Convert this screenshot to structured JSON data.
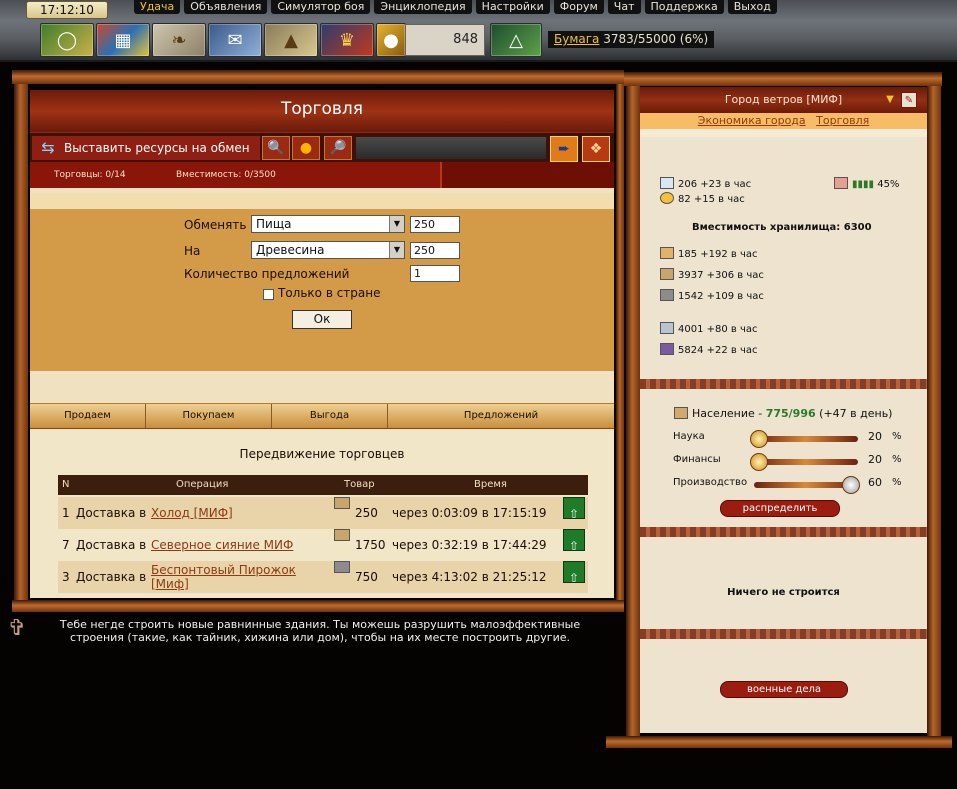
{
  "topbar": {
    "clock": "17:12:10",
    "menu": [
      "Удача",
      "Объявления",
      "Симулятор боя",
      "Энциклопедия",
      "Настройки",
      "Форум",
      "Чат",
      "Поддержка",
      "Выход"
    ],
    "gold": "848",
    "paper_label": "Бумага",
    "paper_value": "3783/55000 (6%)"
  },
  "trade": {
    "title": "Торговля",
    "exchange_button": "Выставить ресурсы на обмен",
    "traders_label": "Торговцы: 0/14",
    "capacity_label": "Вместимость: 0/3500",
    "form": {
      "give_label": "Обменять",
      "give_value": "Пища",
      "give_amount": "250",
      "get_label": "На",
      "get_value": "Древесина",
      "get_amount": "250",
      "count_label": "Количество предложений",
      "count_value": "1",
      "only_country_label": "Только в стране",
      "ok_label": "Ок"
    },
    "offers_columns": [
      "Продаем",
      "Покупаем",
      "Выгода",
      "Предложений"
    ],
    "movement_title": "Передвижение торговцев",
    "movement_columns": [
      "N",
      "Операция",
      "Товар",
      "Время"
    ],
    "movements": [
      {
        "n": "1",
        "op": "Доставка в",
        "dest": "Холод [МИФ]",
        "amount": "250",
        "time": "через 0:03:09 в 17:15:19"
      },
      {
        "n": "7",
        "op": "Доставка в",
        "dest": "Северное сияние МИФ",
        "amount": "1750",
        "time": "через 0:32:19 в 17:44:29"
      },
      {
        "n": "3",
        "op": "Доставка в",
        "dest": "Беспонтовый Пирожок [Миф]",
        "amount": "750",
        "time": "через 4:13:02 в 21:25:12"
      }
    ],
    "tip": "Тебе негде строить новые равнинные здания. Ты можешь разрушить малоэффективные строения (такие, как тайник, хижина или дом), чтобы на их месте построить другие."
  },
  "city": {
    "name": "Город ветров [МИФ]",
    "links": [
      "Экономика города",
      "Торговля"
    ],
    "stat1": "206 +23 в час",
    "stat2": "82 +15 в час",
    "happiness": "45%",
    "storage_label": "Вместимость хранилища: 6300",
    "resources": [
      "185 +192 в час",
      "3937 +306 в час",
      "1542 +109 в час",
      "4001 +80 в час",
      "5824 +22 в час"
    ],
    "population_label": "Население",
    "population_value": "775/996",
    "population_growth": "(+47 в день)",
    "science_label": "Наука",
    "science_pct": "20",
    "finance_label": "Финансы",
    "finance_pct": "20",
    "production_label": "Производство",
    "production_pct": "60",
    "pct_sign": "%",
    "distribute_label": "распределить",
    "build_status": "Ничего не строится",
    "military_label": "военные дела"
  }
}
